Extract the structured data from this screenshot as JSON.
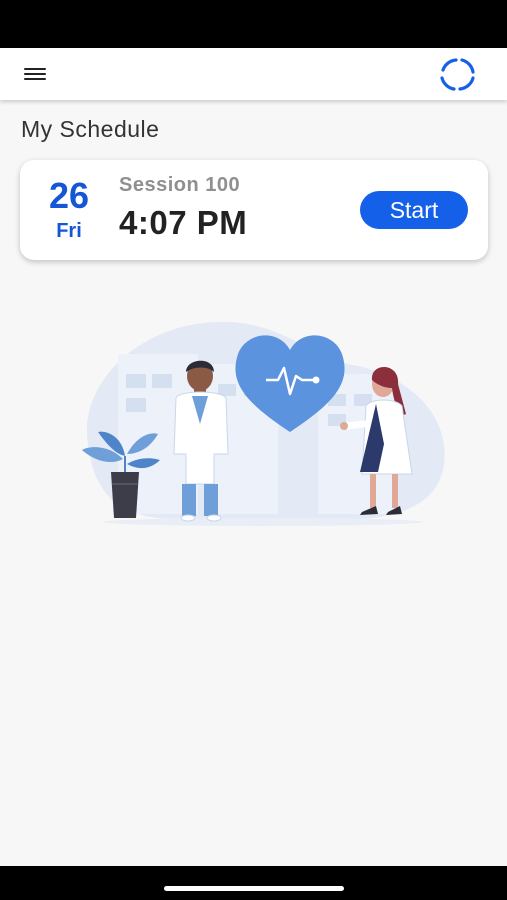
{
  "page": {
    "title": "My Schedule"
  },
  "app_bar": {
    "menu_icon": "hamburger-menu-icon",
    "logo_icon": "circular-logo-icon"
  },
  "session": {
    "day": "26",
    "weekday": "Fri",
    "name": "Session 100",
    "time": "4:07 PM",
    "start_label": "Start"
  },
  "colors": {
    "accent": "#1457d6",
    "button": "#1560e8",
    "illustration_light": "#dde6f5",
    "heart": "#5b93de"
  }
}
